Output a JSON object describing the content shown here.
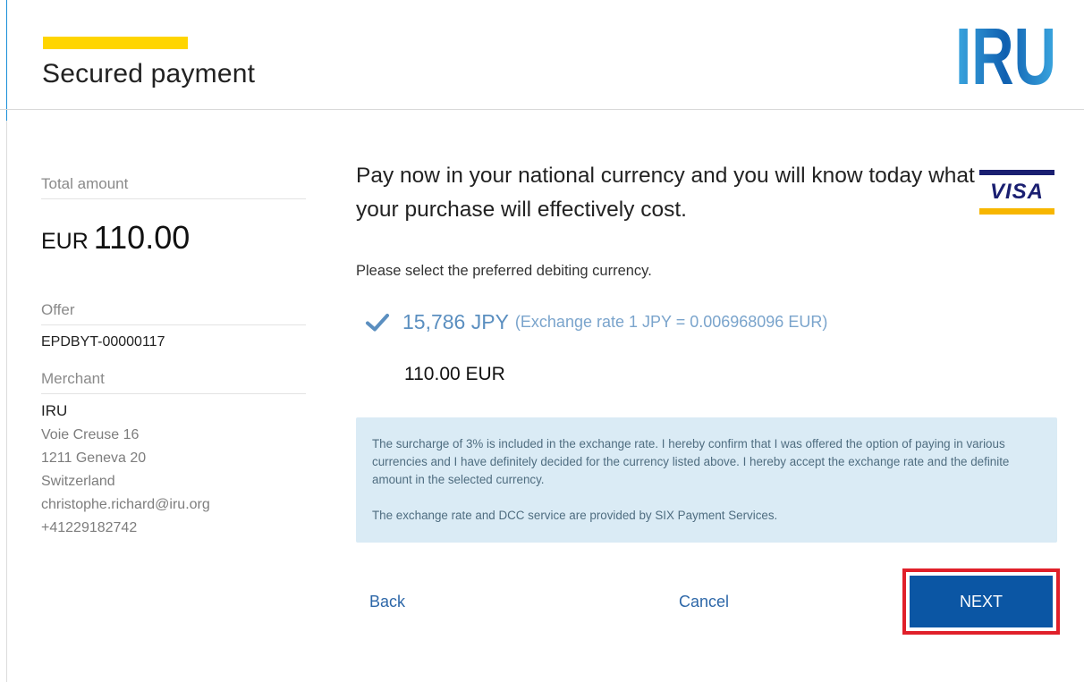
{
  "colors": {
    "accent_yellow": "#ffd500",
    "iru_blue_light": "#3ba7e0",
    "iru_blue_dark": "#1060b0",
    "visa_blue": "#1a1f71",
    "visa_gold": "#f7b600",
    "link_blue": "#2d67a8",
    "next_button": "#0b56a4",
    "highlight_red": "#e0202a"
  },
  "header": {
    "title": "Secured payment",
    "logo_text": "IRU",
    "logo_icon": "iru-logo"
  },
  "sidebar": {
    "total_label": "Total amount",
    "total_currency": "EUR",
    "total_value": "110.00",
    "offer_label": "Offer",
    "offer_id": "EPDBYT-00000117",
    "merchant_label": "Merchant",
    "merchant": {
      "name": "IRU",
      "address_lines": [
        "Voie Creuse 16",
        "1211 Geneva 20",
        "Switzerland"
      ],
      "email": "christophe.richard@iru.org",
      "phone": "+41229182742"
    }
  },
  "main": {
    "headline": "Pay now in your national currency and you will know today what your purchase will effectively cost.",
    "card_brand": "VISA",
    "instruction": "Please select the preferred debiting currency.",
    "selected_option": {
      "icon": "check-icon",
      "amount": "15,786 JPY",
      "rate": "(Exchange rate 1 JPY = 0.006968096 EUR)"
    },
    "alternative_amount": "110.00 EUR",
    "notice": {
      "paragraph1": "The surcharge of 3% is included in the exchange rate. I hereby confirm that I was offered the option of paying in various currencies and I have definitely decided for the currency listed above. I hereby accept the exchange rate and the definite amount in the selected currency.",
      "paragraph2": "The exchange rate and DCC service are provided by SIX Payment Services."
    }
  },
  "actions": {
    "back_label": "Back",
    "cancel_label": "Cancel",
    "next_label": "NEXT"
  }
}
